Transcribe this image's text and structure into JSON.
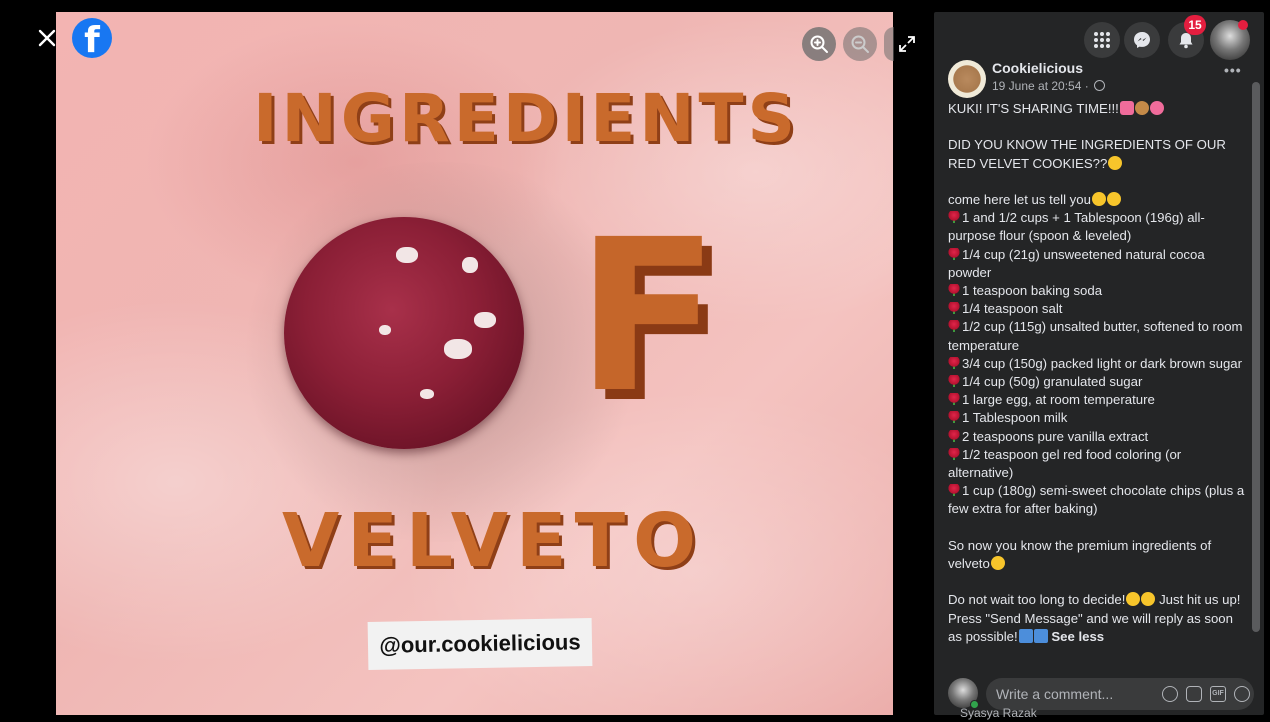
{
  "photo": {
    "headline_top": "INGREDIENTS",
    "headline_letter": "F",
    "headline_bottom": "VELVETO",
    "handle": "@our.cookielicious"
  },
  "icons": {
    "close": "close-icon",
    "logo": "facebook-logo",
    "zoom_in": "zoom-in-icon",
    "zoom_out": "zoom-out-icon",
    "expand": "fullscreen-icon",
    "menu": "grid-menu-icon",
    "messenger": "messenger-icon",
    "notifications": "bell-icon",
    "globe": "globe-icon"
  },
  "topbar": {
    "notification_count": "15"
  },
  "post": {
    "page_name": "Cookielicious",
    "time": "19 June at 20:54 · ",
    "line1": "KUKI! IT'S SHARING TIME!!!",
    "line2": "DID YOU KNOW THE INGREDIENTS OF OUR RED VELVET COOKIES??",
    "line3": "come here let us tell you",
    "ingredients": [
      "1 and 1/2 cups + 1 Tablespoon (196g) all-purpose flour (spoon & leveled)",
      "1/4 cup (21g) unsweetened natural cocoa powder",
      "1 teaspoon baking soda",
      "1/4 teaspoon salt",
      "1/2 cup (115g) unsalted butter, softened to room temperature",
      "3/4 cup (150g) packed light or dark brown sugar",
      "1/4 cup (50g) granulated sugar",
      "1 large egg, at room temperature",
      "1 Tablespoon milk",
      "2 teaspoons pure vanilla extract",
      "1/2 teaspoon gel red food coloring (or alternative)",
      "1 cup (180g) semi-sweet chocolate chips (plus a few extra for after baking)"
    ],
    "line4": "So now you know the premium ingredients of velveto",
    "line5a": "Do not wait too long to decide!",
    "line5b": " Just hit us up! Press \"Send Message\" and we will reply as soon as possible!",
    "see_less": "See less"
  },
  "comment": {
    "placeholder": "Write a comment...",
    "user_name": "Syasya Razak"
  }
}
